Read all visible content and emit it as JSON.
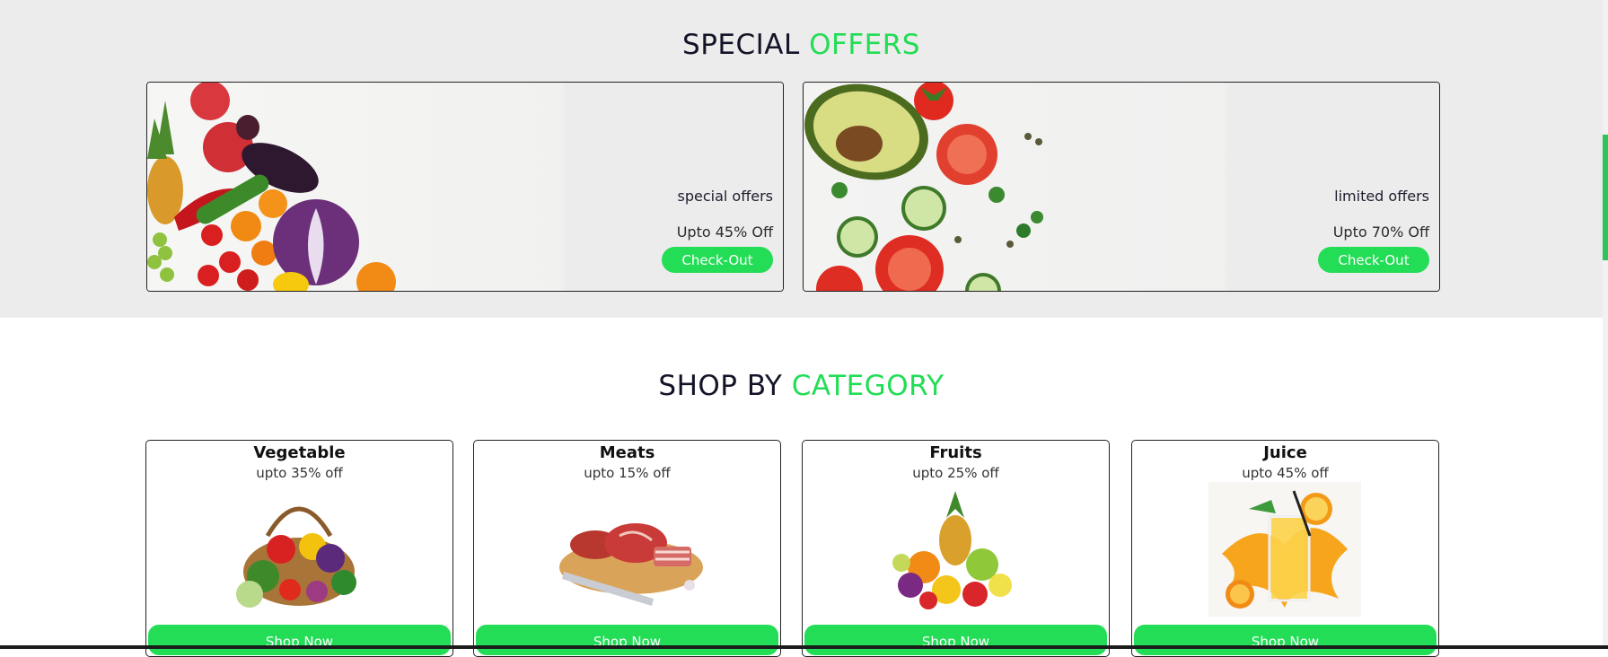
{
  "offers_section": {
    "title_part1": "SPECIAL",
    "title_part2": "OFFERS",
    "banners": [
      {
        "title": "special offers",
        "subtitle": "Upto 45% Off",
        "button_label": "Check-Out"
      },
      {
        "title": "limited offers",
        "subtitle": "Upto 70% Off",
        "button_label": "Check-Out"
      }
    ]
  },
  "category_section": {
    "title_part1": "SHOP BY",
    "title_part2": "CATEGORY",
    "cards": [
      {
        "name": "Vegetable",
        "discount": "upto 35% off",
        "button_label": "Shop Now"
      },
      {
        "name": "Meats",
        "discount": "upto 15% off",
        "button_label": "Shop Now"
      },
      {
        "name": "Fruits",
        "discount": "upto 25% off",
        "button_label": "Shop Now"
      },
      {
        "name": "Juice",
        "discount": "upto 45% off",
        "button_label": "Shop Now"
      }
    ]
  },
  "colors": {
    "accent": "#22dd55",
    "heading": "#141428",
    "offers_background": "#ececec"
  }
}
